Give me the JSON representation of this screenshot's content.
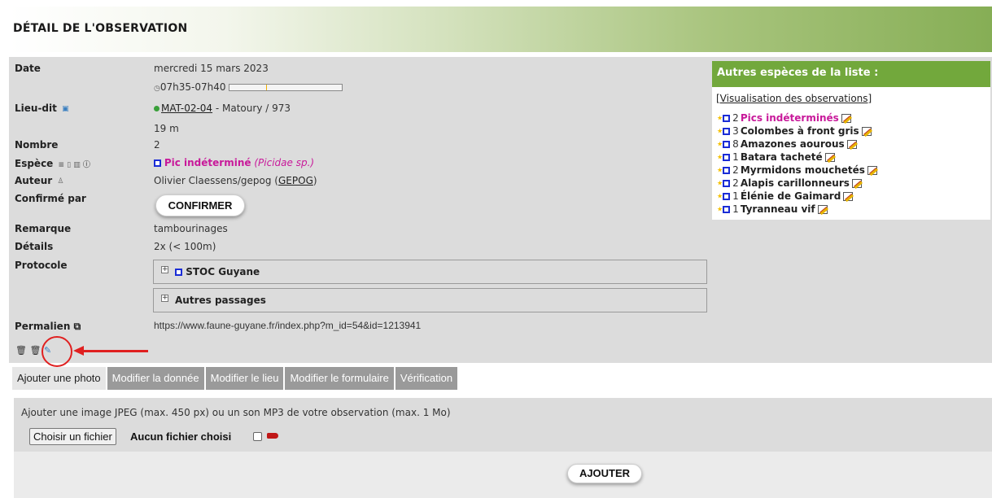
{
  "header": {
    "title": "DÉTAIL DE L'OBSERVATION"
  },
  "fields": {
    "date_label": "Date",
    "date_value": "mercredi 15 mars 2023",
    "time_value": "07h35-07h40",
    "place_label": "Lieu-dit",
    "place_code": "MAT-02-04",
    "place_rest": " - Matoury / 973",
    "altitude": "19 m",
    "count_label": "Nombre",
    "count_value": "2",
    "species_label": "Espèce",
    "species_name": "Pic indéterminé",
    "species_latin": "(Picidae sp.)",
    "author_label": "Auteur",
    "author_name": "Olivier Claessens/gepog (",
    "author_org": "GEPOG",
    "author_close": ")",
    "confirmed_label": "Confirmé par",
    "remark_label": "Remarque",
    "remark_value": "tambourinages",
    "details_label": "Détails",
    "details_value": "2x (< 100m)",
    "protocol_label": "Protocole",
    "protocol_1": "STOC Guyane",
    "protocol_2": "Autres passages",
    "permalink_label": "Permalien",
    "permalink_value": "https://www.faune-guyane.fr/index.php?m_id=54&id=1213941"
  },
  "buttons": {
    "confirm": "CONFIRMER",
    "add": "AJOUTER"
  },
  "sidebar": {
    "title": "Autres espèces de la liste :",
    "link": "[Visualisation des observations]",
    "items": [
      {
        "count": "2",
        "name": "Pics indéterminés",
        "highlight": true
      },
      {
        "count": "3",
        "name": "Colombes à front gris",
        "highlight": false
      },
      {
        "count": "8",
        "name": "Amazones aourous",
        "highlight": false
      },
      {
        "count": "1",
        "name": "Batara tacheté",
        "highlight": false
      },
      {
        "count": "2",
        "name": "Myrmidons mouchetés",
        "highlight": false
      },
      {
        "count": "2",
        "name": "Alapis carillonneurs",
        "highlight": false
      },
      {
        "count": "1",
        "name": "Élénie de Gaimard",
        "highlight": false
      },
      {
        "count": "1",
        "name": "Tyranneau vif",
        "highlight": false
      }
    ]
  },
  "tabs": [
    {
      "label": "Ajouter une photo",
      "active": true
    },
    {
      "label": "Modifier la donnée",
      "active": false
    },
    {
      "label": "Modifier le lieu",
      "active": false
    },
    {
      "label": "Modifier le formulaire",
      "active": false
    },
    {
      "label": "Vérification",
      "active": false
    }
  ],
  "photo": {
    "instruction": "Ajouter une image JPEG (max. 450 px) ou un son MP3 de votre observation (max. 1 Mo)",
    "file_button": "Choisir un fichier",
    "file_status": "Aucun fichier choisi"
  },
  "colors": {
    "accent_green": "#72a83c",
    "species_magenta": "#c8199a",
    "annotation_red": "#e02020",
    "tab_gray": "#9a9a9a"
  },
  "icons": [
    "clock-icon",
    "map-icon",
    "dot-icon",
    "info-icon",
    "user-icon",
    "external-link-icon",
    "trash-icon",
    "edit-icon",
    "star-icon",
    "microphone-icon"
  ]
}
